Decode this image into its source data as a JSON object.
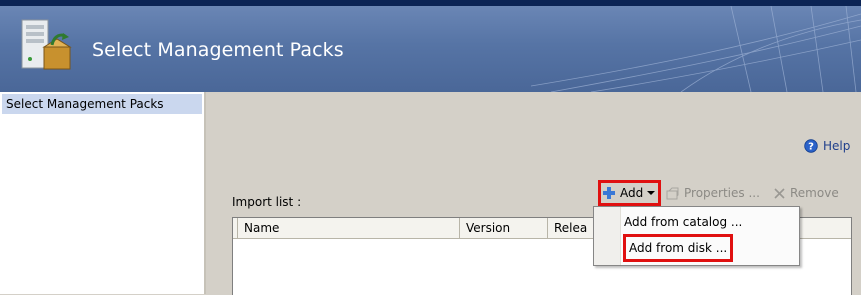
{
  "header": {
    "title": "Select Management Packs"
  },
  "sidebar": {
    "items": [
      {
        "label": "Select Management Packs"
      }
    ]
  },
  "help": {
    "label": "Help"
  },
  "import": {
    "label": "Import list :"
  },
  "toolbar": {
    "add_label": "Add",
    "properties_label": "Properties ...",
    "remove_label": "Remove"
  },
  "table": {
    "columns": [
      "Name",
      "Version",
      "Relea"
    ]
  },
  "add_menu": {
    "items": [
      {
        "label": "Add from catalog ..."
      },
      {
        "label": "Add from disk ..."
      }
    ]
  },
  "colors": {
    "header": "#5674a5",
    "highlight": "#e01010",
    "sidebar_selected": "#cad7ee"
  }
}
